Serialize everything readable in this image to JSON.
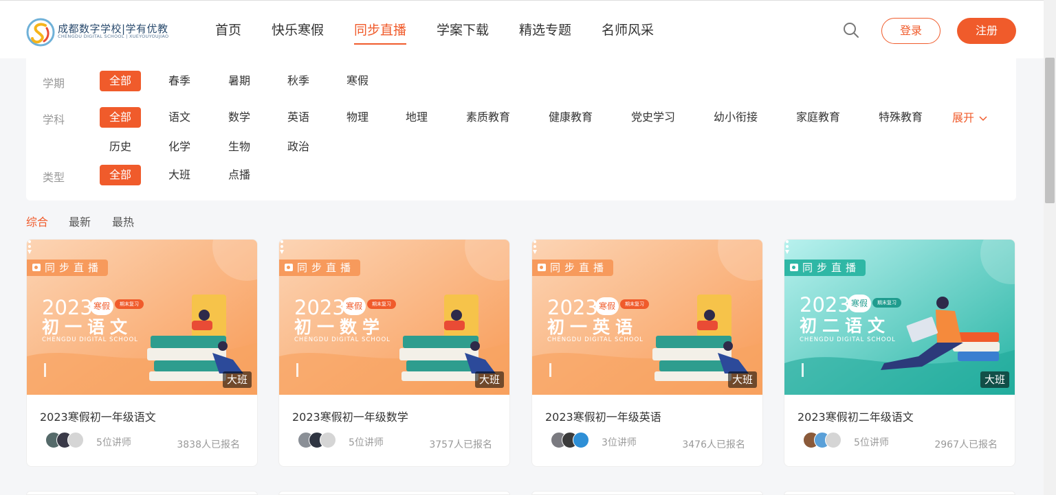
{
  "header": {
    "logo_name": "成都数字学校|学有优教",
    "logo_sub": "CHENGDU DIGITAL SCHOOL | XUEYOUYOUJIAO",
    "nav": [
      "首页",
      "快乐寒假",
      "同步直播",
      "学案下载",
      "精选专题",
      "名师风采"
    ],
    "nav_active": "同步直播",
    "login_label": "登录",
    "register_label": "注册",
    "search_icon": "search-icon"
  },
  "filter": {
    "term_label": "学期",
    "terms": [
      "全部",
      "春季",
      "暑期",
      "秋季",
      "寒假"
    ],
    "subject_label": "学科",
    "subjects": [
      "全部",
      "语文",
      "数学",
      "英语",
      "物理",
      "地理",
      "素质教育",
      "健康教育",
      "党史学习",
      "幼小衔接",
      "家庭教育",
      "特殊教育"
    ],
    "subjects_row2": [
      "历史",
      "化学",
      "生物",
      "政治"
    ],
    "expand_label": "展开",
    "type_label": "类型",
    "types": [
      "全部",
      "大班",
      "点播"
    ]
  },
  "sort": {
    "tabs": [
      "综合",
      "最新",
      "最热"
    ],
    "active": "综合"
  },
  "cards": [
    {
      "theme": "orange",
      "tag": "同步直播",
      "year": "2023",
      "badge_season": "寒假",
      "badge_review": "期末复习",
      "course": "初一语文",
      "school": "CHENGDU DIGITAL SCHOOL",
      "class_type": "大班",
      "title": "2023寒假初一年级语文",
      "teachers": "5位讲师",
      "enrolled": "3838人已报名"
    },
    {
      "theme": "orange",
      "tag": "同步直播",
      "year": "2023",
      "badge_season": "寒假",
      "badge_review": "期末复习",
      "course": "初一数学",
      "school": "CHENGDU DIGITAL SCHOOL",
      "class_type": "大班",
      "title": "2023寒假初一年级数学",
      "teachers": "5位讲师",
      "enrolled": "3757人已报名"
    },
    {
      "theme": "orange",
      "tag": "同步直播",
      "year": "2023",
      "badge_season": "寒假",
      "badge_review": "期末复习",
      "course": "初一英语",
      "school": "CHENGDU DIGITAL SCHOOL",
      "class_type": "大班",
      "title": "2023寒假初一年级英语",
      "teachers": "3位讲师",
      "enrolled": "3476人已报名"
    },
    {
      "theme": "teal",
      "tag": "同步直播",
      "year": "2023",
      "badge_season": "寒假",
      "badge_review": "期末复习",
      "course": "初二语文",
      "school": "CHENGDU DIGITAL SCHOOL",
      "class_type": "大班",
      "title": "2023寒假初二年级语文",
      "teachers": "5位讲师",
      "enrolled": "2967人已报名"
    }
  ],
  "colors": {
    "accent": "#f05b2b",
    "orange_cover": "#fbb07d",
    "teal_cover": "#3cc7b8"
  }
}
